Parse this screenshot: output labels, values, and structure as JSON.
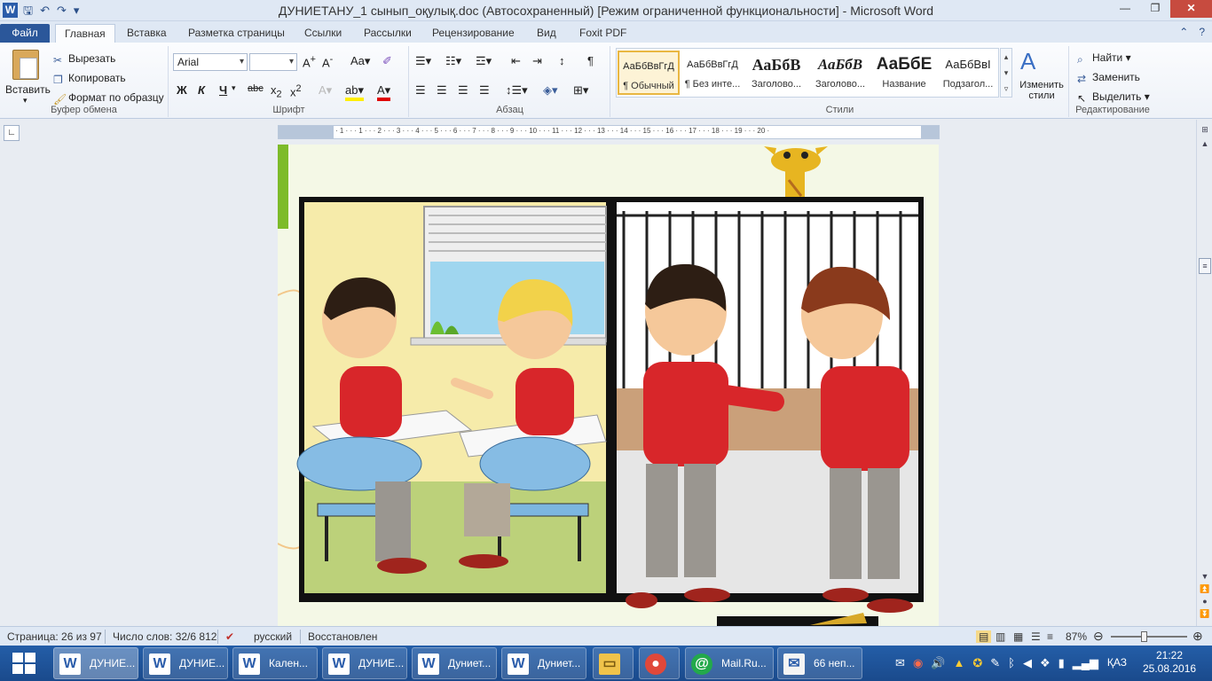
{
  "title_bar": {
    "app_letter": "W",
    "title": "ДУНИЕТАНУ_1 сынып_оқулық.doc (Автосохраненный) [Режим ограниченной функциональности]  -  Microsoft Word"
  },
  "tabs": [
    {
      "label": "Файл"
    },
    {
      "label": "Главная"
    },
    {
      "label": "Вставка"
    },
    {
      "label": "Разметка страницы"
    },
    {
      "label": "Ссылки"
    },
    {
      "label": "Рассылки"
    },
    {
      "label": "Рецензирование"
    },
    {
      "label": "Вид"
    },
    {
      "label": "Foxit PDF"
    }
  ],
  "ribbon": {
    "clipboard": {
      "label": "Буфер обмена",
      "paste": "Вставить",
      "cut": "Вырезать",
      "copy": "Копировать",
      "format_painter": "Формат по образцу"
    },
    "font": {
      "label": "Шрифт",
      "font_name": "Arial",
      "font_size": ""
    },
    "paragraph": {
      "label": "Абзац"
    },
    "styles": {
      "label": "Стили",
      "change_styles": "Изменить стили",
      "items": [
        {
          "sample": "АаБбВвГгД",
          "name": "¶ Обычный"
        },
        {
          "sample": "АаБбВвГгД",
          "name": "¶ Без инте..."
        },
        {
          "sample": "АаБбВ",
          "name": "Заголово..."
        },
        {
          "sample": "АаБбВ",
          "name": "Заголово..."
        },
        {
          "sample": "АаБбЕ",
          "name": "Название"
        },
        {
          "sample": "АаБбВвІ",
          "name": "Подзагол..."
        }
      ]
    },
    "editing": {
      "label": "Редактирование",
      "find": "Найти",
      "replace": "Заменить",
      "select": "Выделить"
    }
  },
  "ruler_numbers": "· 1 · · · 1 · · · 2 · · · 3 · · · 4 · · · 5 · · · 6 · · · 7 · · · 8 · · · 9 · · · 10 · · · 11 · · · 12 · · · 13 · · · 14 · · · 15 · · · 16 · · · 17 · · · 18 · · · 19 · · · 20 ·",
  "status_bar": {
    "page": "Страница: 26 из 97",
    "words": "Число слов: 32/6 812",
    "language": "русский",
    "state": "Восстановлен",
    "zoom": "87%"
  },
  "taskbar": {
    "tasks": [
      {
        "label": "ДУНИЕ..."
      },
      {
        "label": "ДУНИЕ..."
      },
      {
        "label": "Кален..."
      },
      {
        "label": "ДУНИЕ..."
      },
      {
        "label": "Дуниет..."
      },
      {
        "label": "Дуниет..."
      }
    ],
    "mail_ru": "Mail.Ru...",
    "mail_count": "66 неп...",
    "lang": "ҚАЗ",
    "time": "21:22",
    "date": "25.08.2016"
  },
  "colors": {
    "ribbon_accent": "#2b579a",
    "shirt_red": "#d8262a",
    "pants_gray": "#9a9690",
    "scene_green": "#bcd17a"
  }
}
